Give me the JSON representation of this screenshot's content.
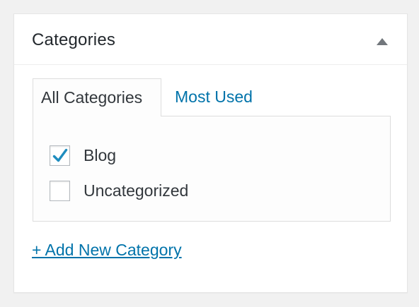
{
  "metabox": {
    "title": "Categories",
    "toggle_icon": "triangle-up-icon"
  },
  "tabs": [
    {
      "label": "All Categories",
      "active": true
    },
    {
      "label": "Most Used",
      "active": false
    }
  ],
  "categories": [
    {
      "label": "Blog",
      "checked": true
    },
    {
      "label": "Uncategorized",
      "checked": false
    }
  ],
  "add_new_label": "+ Add New Category",
  "colors": {
    "link": "#0073aa",
    "check": "#1e8cbe",
    "text": "#32373c",
    "background": "#f1f1f1"
  }
}
